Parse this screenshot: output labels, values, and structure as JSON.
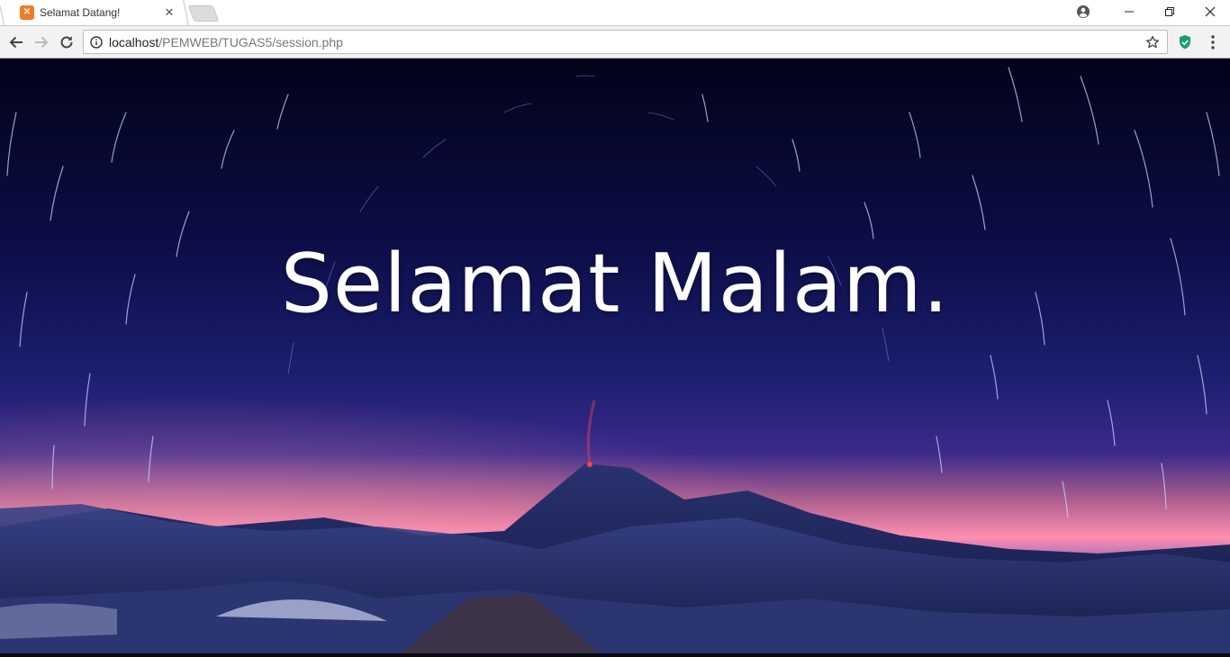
{
  "browser": {
    "tab": {
      "title": "Selamat Datang!",
      "favicon_icon": "xampp-icon",
      "favicon_color": "#f47b20",
      "close_icon": "close-icon"
    },
    "newtab_icon": "new-tab-icon",
    "window_controls": [
      "profile-icon",
      "minimize-icon",
      "restore-icon",
      "close-icon"
    ],
    "address": {
      "host": "localhost",
      "path": "/PEMWEB/TUGAS5/session.php",
      "info_icon": "info-icon",
      "star_icon": "star-icon"
    },
    "extension_icon": "shield-icon",
    "extension_color": "#1a9f6a",
    "menu_icon": "more-vertical-icon"
  },
  "page": {
    "greeting": "Selamat Malam.",
    "background_scene": "star-trails-over-volcano",
    "colors": {
      "sky_top": "#03031a",
      "sky_mid": "#1a1e6e",
      "horizon_glow": "#ff8fb0",
      "mountains": "#1c2558",
      "text": "#ffffff"
    }
  }
}
